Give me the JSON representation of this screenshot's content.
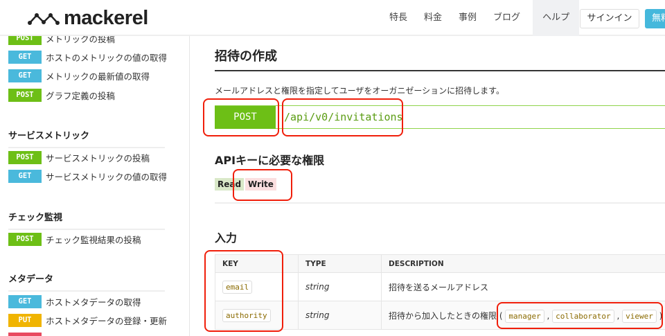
{
  "header": {
    "logo": "mackerel",
    "nav": [
      "特長",
      "料金",
      "事例",
      "ブログ",
      "ヘルプ"
    ],
    "active_nav": "ヘルプ",
    "signin": "サインイン",
    "free": "無料"
  },
  "sidebar": {
    "items_top": [
      {
        "method": "POST",
        "label": "メトリックの投稿"
      },
      {
        "method": "GET",
        "label": "ホストのメトリックの値の取得"
      },
      {
        "method": "GET",
        "label": "メトリックの最新値の取得"
      },
      {
        "method": "POST",
        "label": "グラフ定義の投稿"
      }
    ],
    "sections": [
      {
        "title": "サービスメトリック",
        "items": [
          {
            "method": "POST",
            "label": "サービスメトリックの投稿"
          },
          {
            "method": "GET",
            "label": "サービスメトリックの値の取得"
          }
        ]
      },
      {
        "title": "チェック監視",
        "items": [
          {
            "method": "POST",
            "label": "チェック監視結果の投稿"
          }
        ]
      },
      {
        "title": "メタデータ",
        "items": [
          {
            "method": "GET",
            "label": "ホストメタデータの取得"
          },
          {
            "method": "PUT",
            "label": "ホストメタデータの登録・更新"
          }
        ]
      }
    ]
  },
  "main": {
    "title": "招待の作成",
    "description": "メールアドレスと権限を指定してユーザをオーガニゼーションに招待します。",
    "endpoint": {
      "method": "POST",
      "path": "/api/v0/invitations"
    },
    "permissions_title": "APIキーに必要な権限",
    "permissions": [
      "Read",
      "Write"
    ],
    "input_title": "入力",
    "table": {
      "headers": [
        "KEY",
        "TYPE",
        "DESCRIPTION"
      ],
      "rows": [
        {
          "key": "email",
          "type": "string",
          "description": "招待を送るメールアドレス"
        },
        {
          "key": "authority",
          "type": "string",
          "description": "招待から加入したときの権限",
          "values": [
            "manager",
            "collaborator",
            "viewer"
          ]
        }
      ]
    }
  },
  "colors": {
    "post": "#6dbf16",
    "get": "#4ab9dc",
    "put": "#f0b400",
    "annotation": "#f01e0a"
  }
}
